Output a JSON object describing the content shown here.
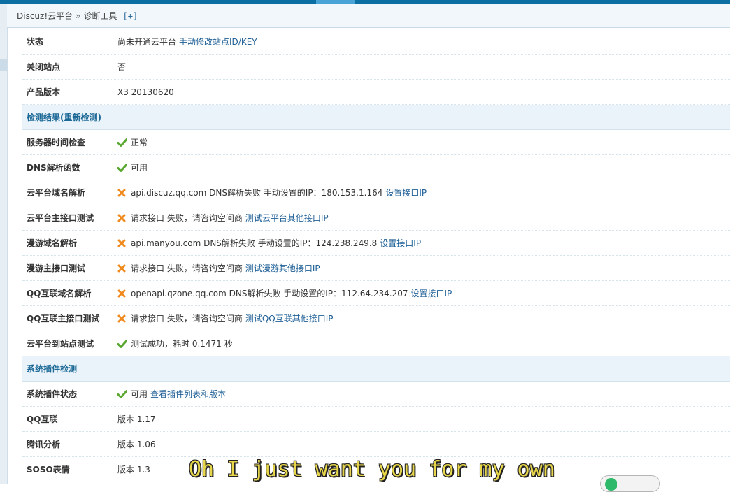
{
  "breadcrumb": {
    "root": "Discuz!云平台",
    "separator": "»",
    "current": "诊断工具",
    "expand": "[+]"
  },
  "info_rows": [
    {
      "label": "状态",
      "text": "尚未开通云平台",
      "link": "手动修改站点ID/KEY"
    },
    {
      "label": "关闭站点",
      "text": "否"
    },
    {
      "label": "产品版本",
      "text": "X3 20130620"
    }
  ],
  "section_checks": {
    "title": "检测结果(重新检测)"
  },
  "check_rows": [
    {
      "label": "服务器时间检查",
      "status": "ok",
      "text": "正常"
    },
    {
      "label": "DNS解析函数",
      "status": "ok",
      "text": "可用"
    },
    {
      "label": "云平台域名解析",
      "status": "error",
      "text": "api.discuz.qq.com DNS解析失败 手动设置的IP：180.153.1.164",
      "link": "设置接口IP"
    },
    {
      "label": "云平台主接口测试",
      "status": "error",
      "text": "请求接口 失败，请咨询空间商",
      "link": "测试云平台其他接口IP"
    },
    {
      "label": "漫游域名解析",
      "status": "error",
      "text": "api.manyou.com DNS解析失败 手动设置的IP：124.238.249.8",
      "link": "设置接口IP"
    },
    {
      "label": "漫游主接口测试",
      "status": "error",
      "text": "请求接口 失败，请咨询空间商",
      "link": "测试漫游其他接口IP"
    },
    {
      "label": "QQ互联域名解析",
      "status": "error",
      "text": "openapi.qzone.qq.com DNS解析失败 手动设置的IP：112.64.234.207",
      "link": "设置接口IP"
    },
    {
      "label": "QQ互联主接口测试",
      "status": "error",
      "text": "请求接口 失败，请咨询空间商",
      "link": "测试QQ互联其他接口IP"
    },
    {
      "label": "云平台到站点测试",
      "status": "ok",
      "text": "测试成功，耗时 0.1471 秒"
    }
  ],
  "section_plugins": {
    "title": "系统插件检测"
  },
  "plugin_rows": [
    {
      "label": "系统插件状态",
      "status": "ok",
      "text": "可用",
      "link": "查看插件列表和版本"
    },
    {
      "label": "QQ互联",
      "text": "版本 1.17"
    },
    {
      "label": "腾讯分析",
      "text": "版本 1.06"
    },
    {
      "label": "SOSO表情",
      "text": "版本 1.3"
    }
  ],
  "overlay": {
    "subtitle": "Oh I just want you for my own"
  },
  "colors": {
    "accent": "#0b6fa4",
    "link": "#1e5f96",
    "ok": "#5aa832",
    "error": "#f08a1e"
  }
}
